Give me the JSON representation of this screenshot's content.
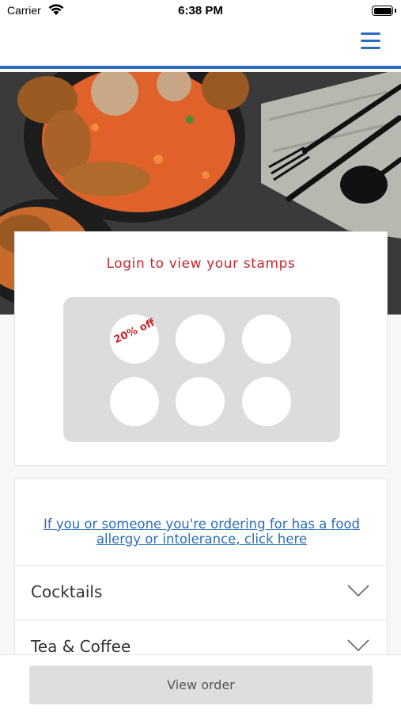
{
  "status_bar": {
    "carrier": "Carrier",
    "time": "6:38 PM"
  },
  "nav": {
    "menu_icon": "hamburger-menu-icon",
    "accent_color": "#2c6bc1"
  },
  "stamps": {
    "title": "Login to view your stamps",
    "reward_label": "20% off",
    "total_stamps": 6,
    "title_color": "#c6272b"
  },
  "menu": {
    "allergy_link": "If you or someone you're ordering for has a food allergy or intolerance, click here",
    "categories": [
      {
        "label": "Cocktails"
      },
      {
        "label": "Tea & Coffee"
      }
    ]
  },
  "footer": {
    "view_order_label": "View order"
  }
}
